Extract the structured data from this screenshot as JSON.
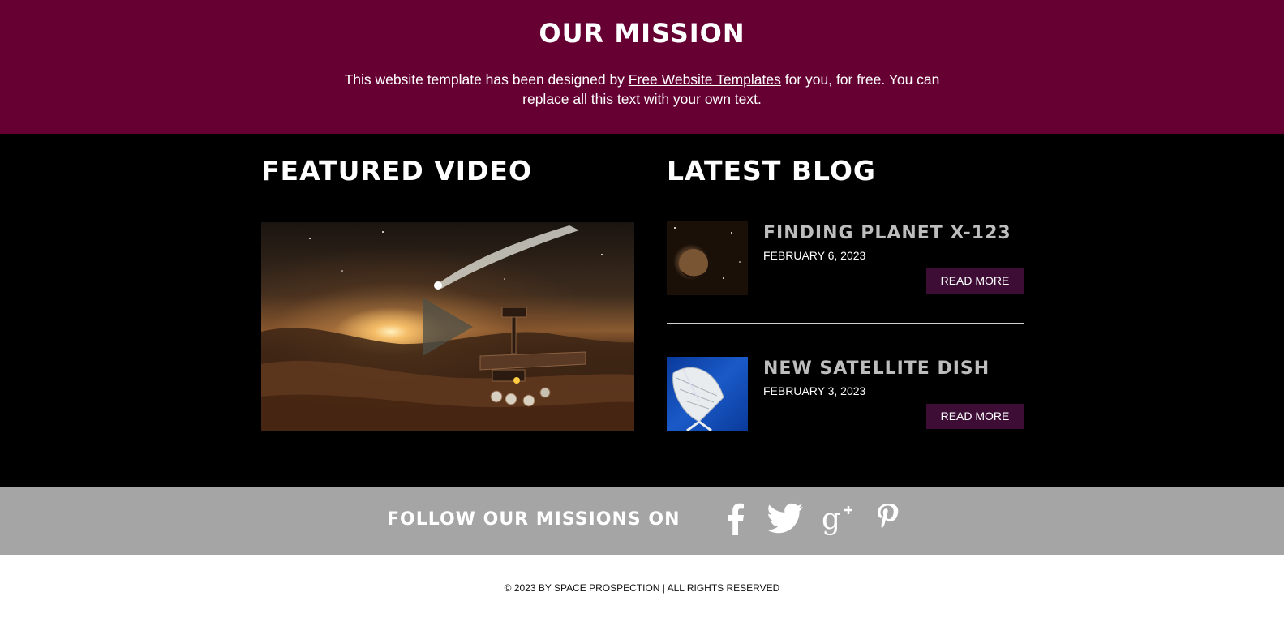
{
  "mission": {
    "title": "OUR MISSION",
    "text_before": "This website template has been designed by ",
    "link_text": "Free Website Templates",
    "text_after": " for you, for free. You can replace all this text with your own text."
  },
  "featured_video": {
    "title": "FEATURED VIDEO",
    "play_icon": "play-icon"
  },
  "latest_blog": {
    "title": "LATEST BLOG",
    "posts": [
      {
        "title": "FINDING PLANET X-123",
        "date": "FEBRUARY 6, 2023",
        "button": "READ MORE"
      },
      {
        "title": "NEW SATELLITE DISH",
        "date": "FEBRUARY 3, 2023",
        "button": "READ MORE"
      }
    ]
  },
  "follow": {
    "label": "FOLLOW OUR MISSIONS ON",
    "icons": [
      "facebook-icon",
      "twitter-icon",
      "google-plus-icon",
      "pinterest-icon"
    ]
  },
  "footer": {
    "copyright": "© 2023 BY SPACE PROSPECTION | ALL RIGHTS RESERVED"
  },
  "colors": {
    "mission_bg": "#660033",
    "content_bg": "#000000",
    "follow_bg": "#a5a5a5",
    "button_bg": "#3d0d36",
    "post_title": "#bdbdbd"
  }
}
